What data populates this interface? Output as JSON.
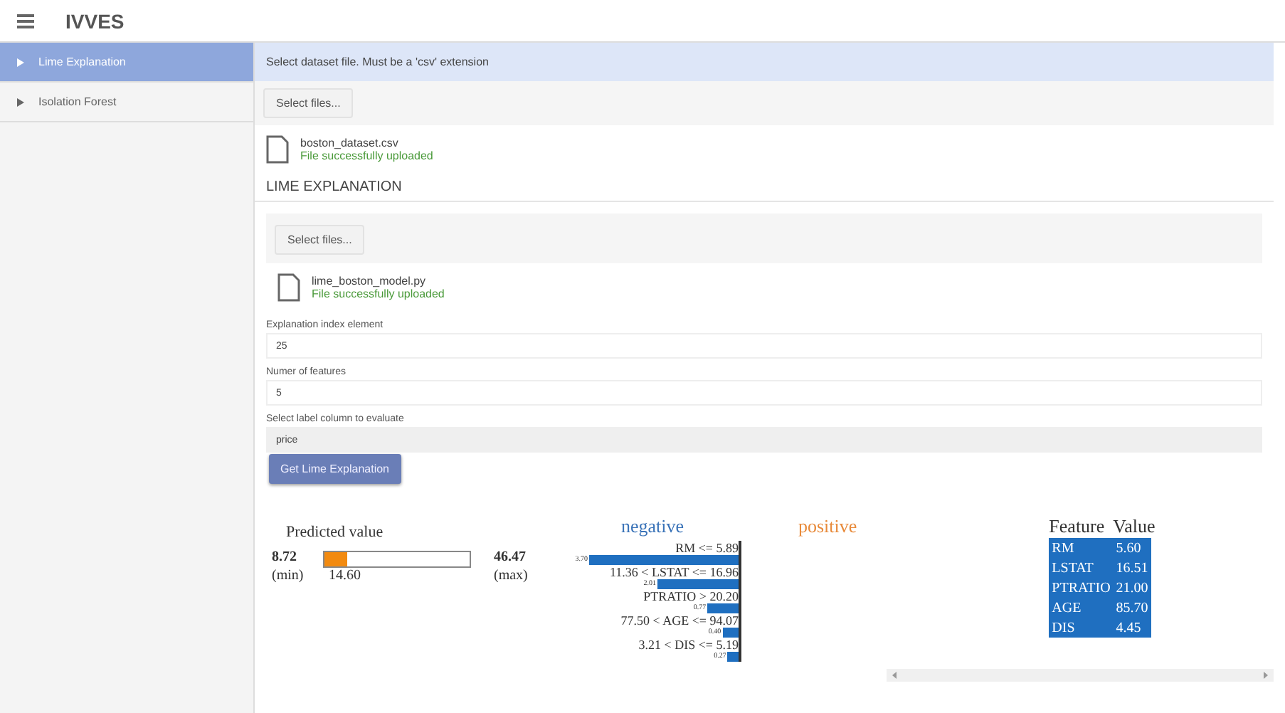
{
  "app": {
    "title": "IVVES"
  },
  "sidebar": {
    "items": [
      {
        "label": "Lime Explanation",
        "selected": true
      },
      {
        "label": "Isolation Forest",
        "selected": false
      }
    ]
  },
  "dataset": {
    "banner": "Select dataset file. Must be a 'csv' extension",
    "button": "Select files...",
    "file": {
      "name": "boston_dataset.csv",
      "status": "File successfully uploaded"
    }
  },
  "section_title": "LIME EXPLANATION",
  "model": {
    "button": "Select files...",
    "file": {
      "name": "lime_boston_model.py",
      "status": "File successfully uploaded"
    }
  },
  "fields": [
    {
      "label": "Explanation index element",
      "value": "25",
      "kind": "input"
    },
    {
      "label": "Numer of features",
      "value": "5",
      "kind": "input"
    },
    {
      "label": "Select label column to evaluate",
      "value": "price",
      "kind": "select"
    }
  ],
  "action_button": "Get Lime Explanation",
  "prediction": {
    "title": "Predicted value",
    "min": "8.72",
    "min_label": "(min)",
    "max": "46.47",
    "max_label": "(max)",
    "value": "14.60",
    "level": 0.156
  },
  "contributions": {
    "negative_title": "negative",
    "positive_title": "positive",
    "items": [
      {
        "condition": "RM <= 5.89",
        "value": "3.70"
      },
      {
        "condition": "11.36 < LSTAT <= 16.96",
        "value": "2.01"
      },
      {
        "condition": "PTRATIO > 20.20",
        "value": "0.77"
      },
      {
        "condition": "77.50 < AGE <= 94.07",
        "value": "0.40"
      },
      {
        "condition": "3.21 < DIS <= 5.19",
        "value": "0.27"
      }
    ]
  },
  "feature_table": {
    "columns": [
      "Feature",
      "Value"
    ],
    "rows": [
      [
        "RM",
        "5.60"
      ],
      [
        "LSTAT",
        "16.51"
      ],
      [
        "PTRATIO",
        "21.00"
      ],
      [
        "AGE",
        "85.70"
      ],
      [
        "DIS",
        "4.45"
      ]
    ]
  }
}
